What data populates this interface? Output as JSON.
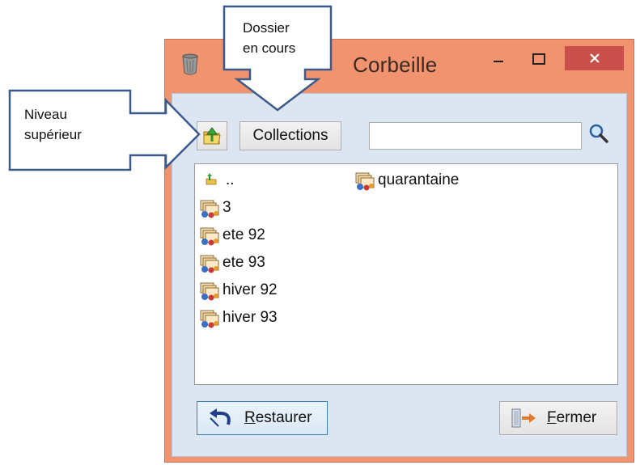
{
  "window": {
    "title": "Corbeille",
    "controls": {
      "minimize": "–",
      "maximize": "□",
      "close": "✕"
    }
  },
  "toolbar": {
    "up_tooltip": "Niveau supérieur",
    "current_folder_label": "Collections",
    "search": {
      "value": "",
      "placeholder": ""
    }
  },
  "list": {
    "items": [
      {
        "label": "..",
        "icon": "up-folder-icon"
      },
      {
        "label": "3",
        "icon": "collection-icon"
      },
      {
        "label": "ete 92",
        "icon": "collection-icon"
      },
      {
        "label": "ete 93",
        "icon": "collection-icon"
      },
      {
        "label": "hiver 92",
        "icon": "collection-icon"
      },
      {
        "label": "hiver 93",
        "icon": "collection-icon"
      },
      {
        "label": "quarantaine",
        "icon": "collection-icon"
      }
    ]
  },
  "buttons": {
    "restore": {
      "mnemonic": "R",
      "rest": "estaurer"
    },
    "close": {
      "mnemonic": "F",
      "rest": "ermer"
    }
  },
  "annotations": {
    "current_folder": "Dossier\nen cours",
    "parent_level": "Niveau\nsupérieur"
  },
  "colors": {
    "title_bar": "#f0936e",
    "close_button": "#c94f4a",
    "client": "#dce6f2",
    "callout_border": "#3c5a8a"
  }
}
